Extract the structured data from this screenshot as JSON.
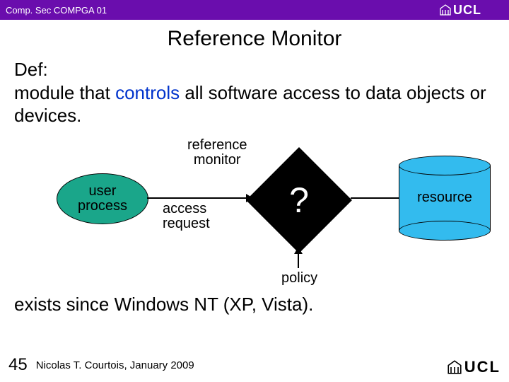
{
  "header": {
    "course": "Comp. Sec COMPGA 01",
    "logo_text": "UCL"
  },
  "title": "Reference Monitor",
  "definition": {
    "lead": "Def:",
    "pre": "module that ",
    "controls": "controls",
    "post": " all software access to data objects or devices."
  },
  "diagram": {
    "user_line1": "user",
    "user_line2": "process",
    "ref_line1": "reference",
    "ref_line2": "monitor",
    "access_line1": "access",
    "access_line2": "request",
    "question": "?",
    "resource": "resource",
    "policy": "policy"
  },
  "since": "exists since Windows NT (XP, Vista).",
  "footer": {
    "page": "45",
    "author": "Nicolas T. Courtois, January 2009",
    "logo_text": "UCL"
  }
}
